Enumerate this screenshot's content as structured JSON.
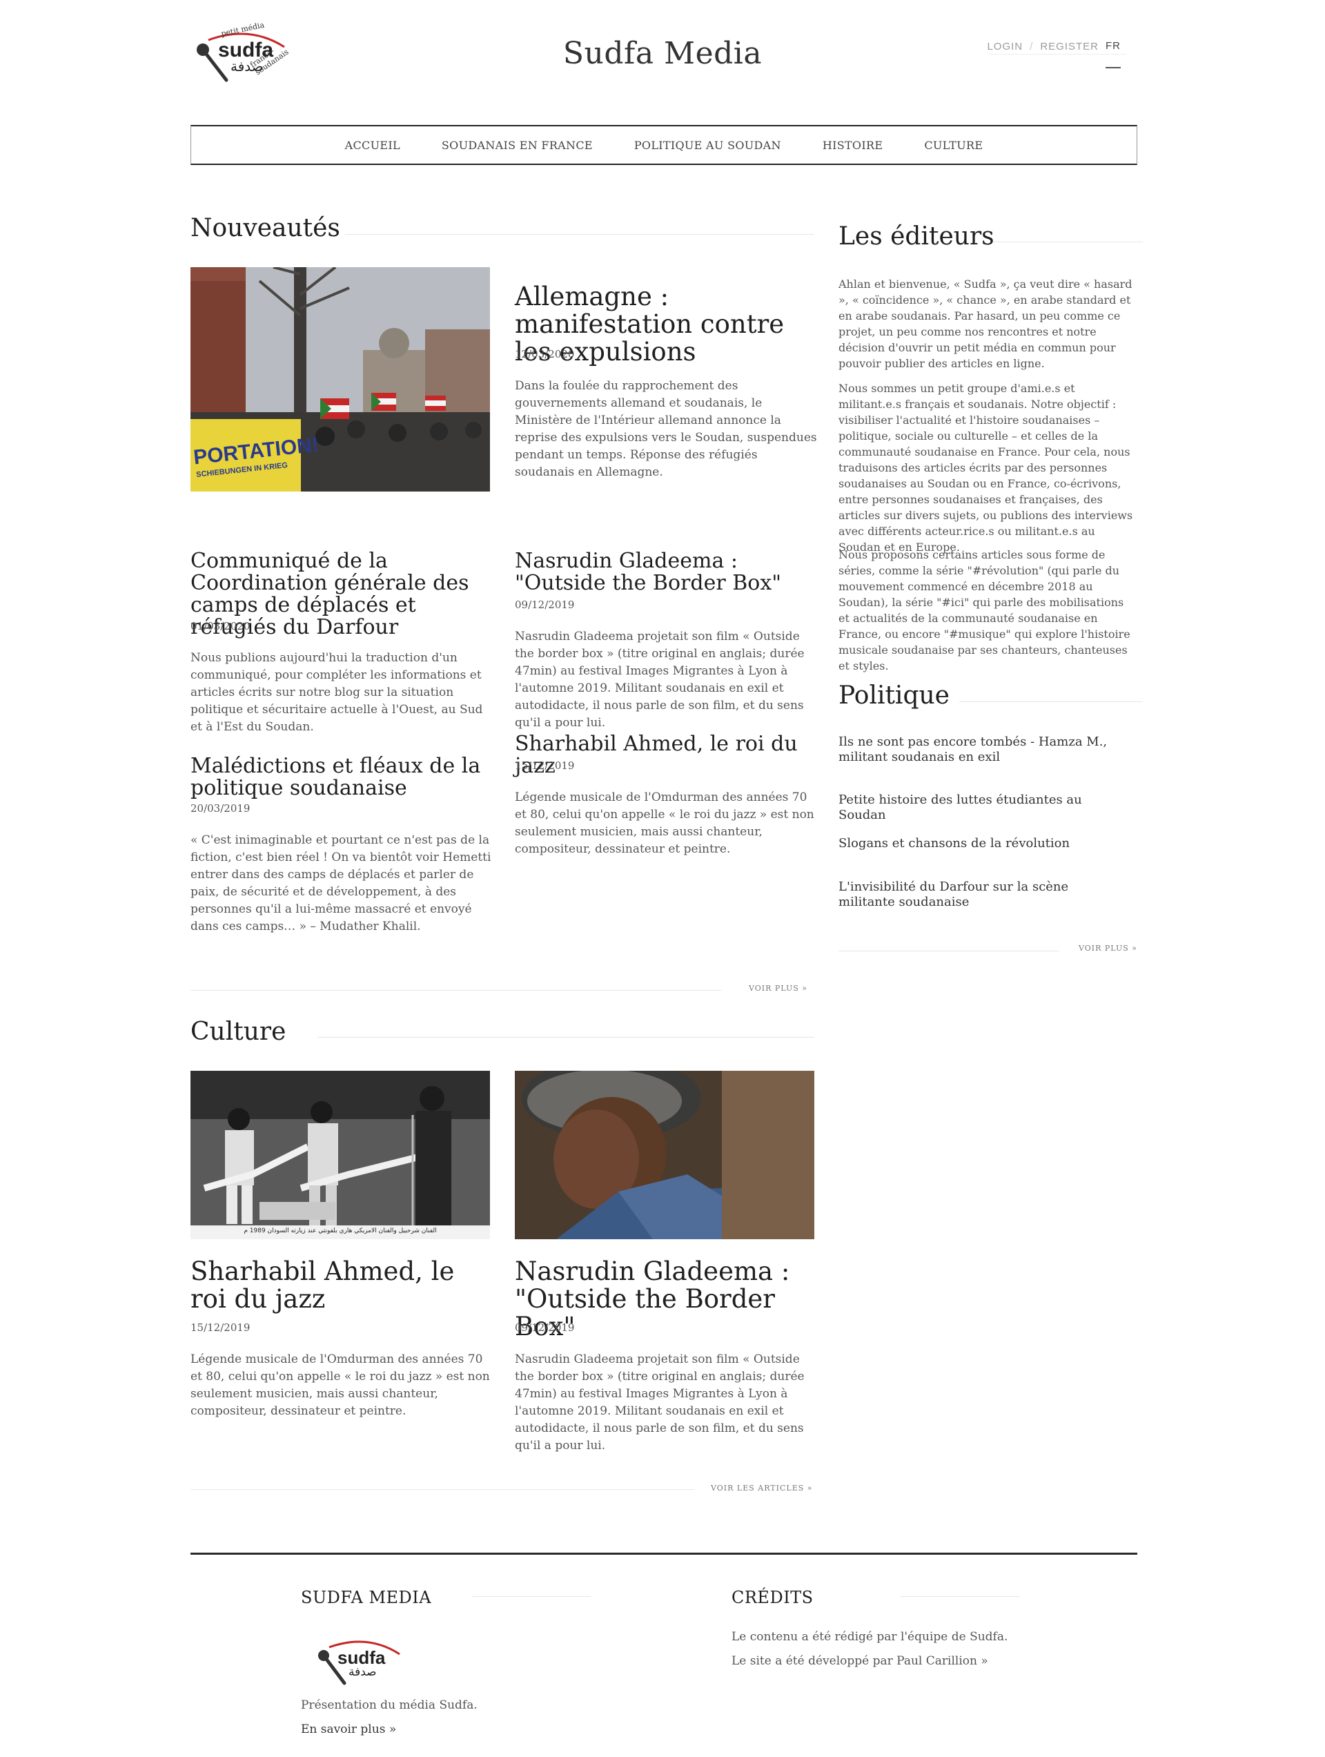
{
  "header": {
    "logo_text": "sudfa",
    "logo_sub_top": "petit média",
    "logo_sub_bottom": "franco-soudanais",
    "logo_arabic": "صدفة",
    "site_title": "Sudfa Media",
    "login": "LOGIN",
    "sep": "/",
    "register": "REGISTER",
    "lang": "FR"
  },
  "nav": {
    "items": [
      "ACCUEIL",
      "SOUDANAIS EN FRANCE",
      "POLITIQUE AU SOUDAN",
      "HISTOIRE",
      "CULTURE"
    ]
  },
  "nouveautes": {
    "title": "Nouveautés",
    "featured": {
      "title": "Allemagne : manifestation contre les expulsions",
      "date": "12/03/2020",
      "text": "Dans la foulée du rapprochement des gouvernements allemand et soudanais, le Ministère de l'Intérieur allemand annonce la reprise des expulsions vers le Soudan, suspendues pendant un temps. Réponse des réfugiés soudanais en Allemagne.",
      "image_banner": "PORTATION!",
      "image_banner_sub": "SCHIEBUNGEN IN KRIEG"
    },
    "articles": [
      {
        "title": "Communiqué de la Coordination générale des camps de déplacés et réfugiés du Darfour",
        "date": "01/03/2020",
        "text": "Nous publions aujourd'hui la traduction d'un communiqué, pour compléter les informations et articles écrits sur notre blog sur la situation politique et sécuritaire actuelle à l'Ouest, au Sud et à l'Est du Soudan."
      },
      {
        "title": "Nasrudin Gladeema : \"Outside the Border Box\"",
        "date": "09/12/2019",
        "text": "Nasrudin Gladeema projetait son film « Outside the border box » (titre original en anglais; durée 47min) au festival Images Migrantes à Lyon à l'automne 2019. Militant soudanais en exil et autodidacte, il nous parle de son film, et du sens qu'il a pour lui."
      },
      {
        "title": "Malédictions et fléaux de la politique soudanaise",
        "date": "20/03/2019",
        "text": "« C'est inimaginable et pourtant ce n'est pas de la fiction, c'est bien réel ! On va bientôt voir Hemetti entrer dans des camps de déplacés et parler de paix, de sécurité et de développement, à des personnes qu'il a lui-même massacré et envoyé dans ces camps… » – Mudather Khalil."
      },
      {
        "title": "Sharhabil Ahmed, le roi du jazz",
        "date": "15/12/2019",
        "text": "Légende musicale de l'Omdurman des années 70 et 80, celui qu'on appelle « le roi du jazz » est non seulement musicien, mais aussi chanteur, compositeur, dessinateur et peintre."
      }
    ],
    "more": "VOIR PLUS »"
  },
  "culture": {
    "title": "Culture",
    "articles": [
      {
        "title": "Sharhabil Ahmed, le roi du jazz",
        "date": "15/12/2019",
        "text": "Légende musicale de l'Omdurman des années 70 et 80, celui qu'on appelle « le roi du jazz » est non seulement musicien, mais aussi chanteur, compositeur, dessinateur et peintre.",
        "image_caption": "الفنان شرحبيل والفنان الامريكي هاري بلفونتي عند زيارته السودان 1989 م"
      },
      {
        "title": "Nasrudin Gladeema : \"Outside the Border Box\"",
        "date": "09/12/2019",
        "text": "Nasrudin Gladeema projetait son film « Outside the border box » (titre original en anglais; durée 47min) au festival Images Migrantes à Lyon à l'automne 2019. Militant soudanais en exil et autodidacte, il nous parle de son film, et du sens qu'il a pour lui."
      }
    ],
    "more": "VOIR LES ARTICLES »"
  },
  "sidebar": {
    "editors_title": "Les éditeurs",
    "paragraphs": [
      "Ahlan et bienvenue, « Sudfa », ça veut dire « hasard », « coïncidence », « chance », en arabe standard et en arabe soudanais. Par hasard, un peu comme ce projet, un peu comme nos rencontres et notre décision d'ouvrir un petit média en commun pour pouvoir publier des articles en ligne.",
      "Nous sommes un petit groupe d'ami.e.s et militant.e.s français et soudanais. Notre objectif : visibiliser l'actualité et l'histoire soudanaises – politique, sociale ou culturelle – et celles de la communauté soudanaise en France. Pour cela, nous traduisons des articles écrits par des personnes soudanaises au Soudan ou en France, co-écrivons, entre personnes soudanaises et françaises, des articles sur divers sujets, ou publions des interviews avec différents acteur.rice.s ou militant.e.s au Soudan et en Europe.",
      "Nous proposons certains articles sous forme de séries, comme la série \"#révolution\" (qui parle du mouvement commencé en décembre 2018 au Soudan), la série \"#ici\" qui parle des mobilisations et actualités de la communauté soudanaise en France, ou encore \"#musique\" qui explore l'histoire musicale soudanaise par ses chanteurs, chanteuses et styles."
    ],
    "politique_title": "Politique",
    "politique_items": [
      "Ils ne sont pas encore tombés - Hamza M., militant soudanais en exil",
      "Petite histoire des luttes étudiantes au Soudan",
      "Slogans et chansons de la révolution",
      "L'invisibilité du Darfour sur la scène militante soudanaise"
    ],
    "more": "VOIR PLUS »"
  },
  "footer": {
    "left_title": "SUDFA MEDIA",
    "left_text": "Présentation du média Sudfa.",
    "left_link": "En savoir plus »",
    "right_title": "CRÉDITS",
    "right_text_1": "Le contenu a été rédigé par l'équipe de Sudfa.",
    "right_text_2": "Le site a été développé par Paul Carillion  »"
  }
}
